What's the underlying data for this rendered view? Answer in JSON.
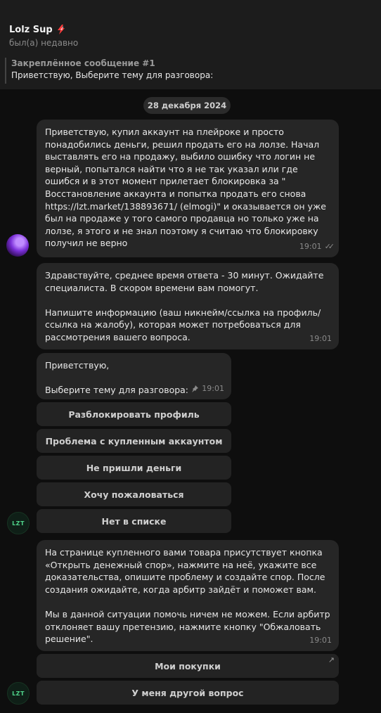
{
  "header": {
    "title": "Lolz Sup",
    "title_icon": "lightning-bolt-icon",
    "status": "был(а) недавно",
    "pinned_label": "Закреплённое сообщение #1",
    "pinned_text": "Приветствую,  Выберите тему для разговора:"
  },
  "date_separator": "28 декабря 2024",
  "messages": [
    {
      "text": "Приветствую, купил аккаунт на плейроке и просто понадобились деньги, решил продать его на лолзе. Начал выставлять его на продажу, выбило ошибку что логин не верный, попытался найти что я не так указал или где ошибся и в этот момент прилетает блокировка за \" Восстановление аккаунта и попытка продать его снова https://lzt.market/138893671/ (elmogi)\" и оказывается он уже был на продаже у того самого продавца но только уже на лолзе, я этого и не знал поэтому я считаю что блокировку получил не верно",
      "time": "19:01"
    },
    {
      "text": "Здравствуйте, среднее время ответа - 30 минут. Ожидайте специалиста. В скором времени вам помогут.\n\nНапишите информацию (ваш никнейм/ссылка на профиль/ссылка на жалобу), которая может потребоваться для рассмотрения вашего вопроса.",
      "time": "19:01"
    },
    {
      "text": "Приветствую,\n\nВыберите тему для разговора:",
      "time": "19:01"
    },
    {
      "text": "На странице купленного вами товара присутствует кнопка «Открыть денежный спор», нажмите на неё, укажите все доказательства, опишите проблему и создайте спор. После создания ожидайте, когда арбитр зайдёт и поможет вам.\n\nМы в данной ситуации помочь ничем не можем. Если арбитр отклоняет вашу претензию, нажмите кнопку \"Обжаловать решение\".",
      "time": "19:01"
    }
  ],
  "keyboard1": [
    "Разблокировать профиль",
    "Проблема с купленным аккаунтом",
    "Не пришли деньги",
    "Хочу пожаловаться",
    "Нет в списке"
  ],
  "keyboard2": [
    "Мои покупки",
    "У меня другой вопрос"
  ],
  "avatars": {
    "bot_text": "LZT"
  },
  "colors": {
    "background": "#0e0e0e",
    "header": "#1c1c1c",
    "bubble": "#262626",
    "button": "#232323",
    "bot_accent": "#4fd38a"
  }
}
